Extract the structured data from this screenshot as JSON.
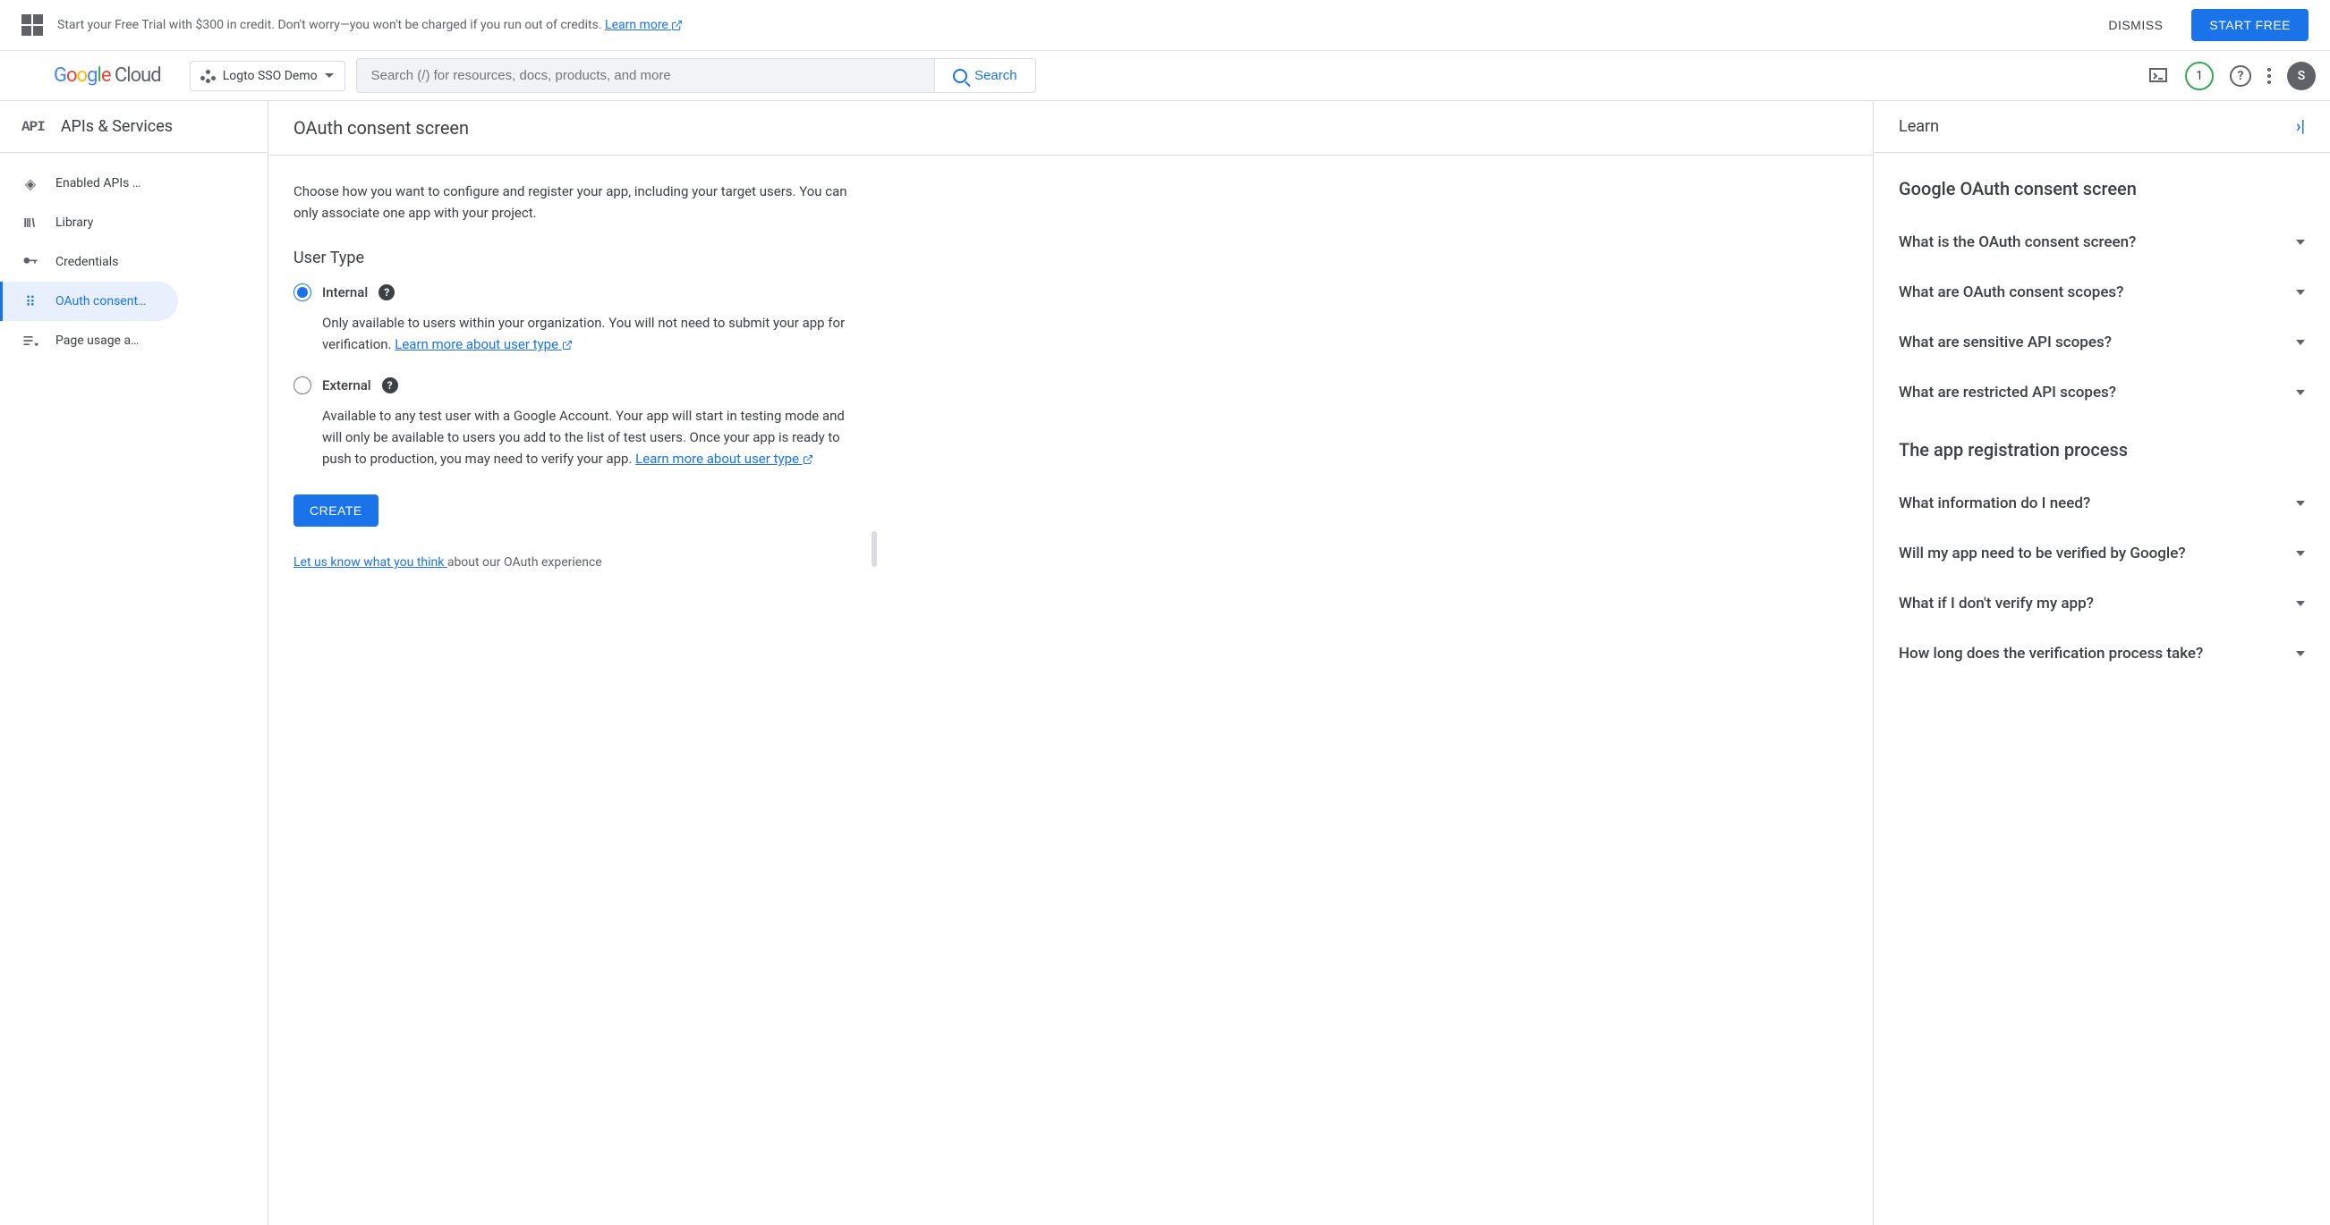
{
  "promo": {
    "text": "Start your Free Trial with $300 in credit. Don't worry—you won't be charged if you run out of credits. ",
    "link_text": "Learn more",
    "dismiss": "DISMISS",
    "start_free": "START FREE"
  },
  "header": {
    "logo_cloud": " Cloud",
    "project_name": "Logto SSO Demo",
    "search_placeholder": "Search (/) for resources, docs, products, and more",
    "search_btn": "Search",
    "notif_count": "1",
    "avatar_letter": "S"
  },
  "sidebar": {
    "title": "APIs & Services",
    "items": [
      {
        "label": "Enabled APIs …",
        "icon": "diamond"
      },
      {
        "label": "Library",
        "icon": "library"
      },
      {
        "label": "Credentials",
        "icon": "key"
      },
      {
        "label": "OAuth consent…",
        "icon": "consent"
      },
      {
        "label": "Page usage a…",
        "icon": "page"
      }
    ]
  },
  "main": {
    "title": "OAuth consent screen",
    "intro": "Choose how you want to configure and register your app, including your target users. You can only associate one app with your project.",
    "section_title": "User Type",
    "internal": {
      "label": "Internal",
      "desc_pre": "Only available to users within your organization. You will not need to submit your app for verification. ",
      "link": "Learn more about user type"
    },
    "external": {
      "label": "External",
      "desc_pre": "Available to any test user with a Google Account. Your app will start in testing mode and will only be available to users you add to the list of test users. Once your app is ready to push to production, you may need to verify your app. ",
      "link": "Learn more about user type"
    },
    "create_btn": "CREATE",
    "feedback_link": "Let us know what you think ",
    "feedback_rest": "about our OAuth experience"
  },
  "learn": {
    "title": "Learn",
    "section1_title": "Google OAuth consent screen",
    "section1_items": [
      "What is the OAuth consent screen?",
      "What are OAuth consent scopes?",
      "What are sensitive API scopes?",
      "What are restricted API scopes?"
    ],
    "section2_title": "The app registration process",
    "section2_items": [
      "What information do I need?",
      "Will my app need to be verified by Google?",
      "What if I don't verify my app?",
      "How long does the verification process take?"
    ]
  }
}
